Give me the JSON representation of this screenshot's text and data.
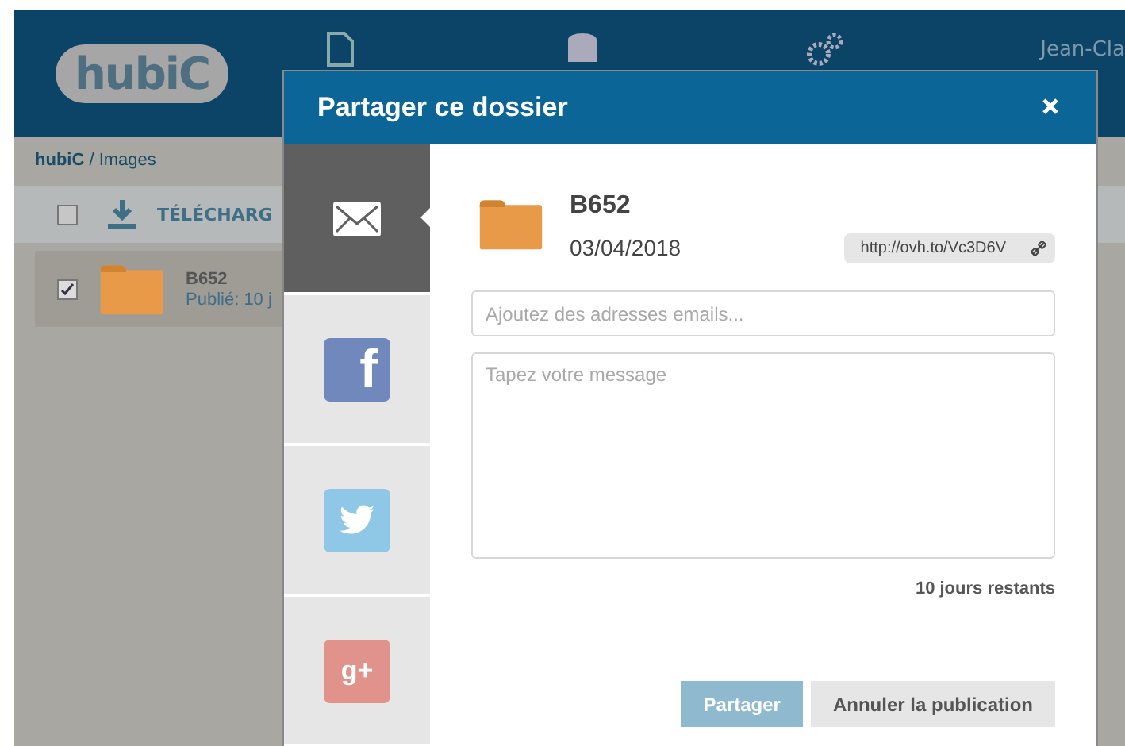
{
  "header": {
    "logo": "hubiC",
    "user": "Jean-Cla"
  },
  "breadcrumb": "**hubiC** / Images",
  "toolbar": {
    "select_all_checked": false,
    "download_label": "TÉLÉCHARG"
  },
  "files": [
    {
      "name": "B652",
      "status": "Publié: 10 j",
      "checked": true,
      "selected": true
    }
  ],
  "dialog": {
    "title": "Partager ce dossier",
    "share_tabs": [
      {
        "kind": "email",
        "selected": true
      },
      {
        "kind": "facebook",
        "glyph": "f",
        "selected": false
      },
      {
        "kind": "twitter",
        "selected": false
      },
      {
        "kind": "googleplus",
        "glyph": "g+",
        "selected": false
      }
    ],
    "folder_name": "B652",
    "date": "03/04/2018",
    "link": "http://ovh.to/Vc3D6V",
    "email_placeholder": "Ajoutez des adresses emails...",
    "message_placeholder": "Tapez votre message",
    "remaining": "10 jours restants",
    "buttons": [
      {
        "label": "Partager",
        "disabled": true,
        "kind": "primary"
      },
      {
        "label": "Annuler la publication",
        "disabled": false,
        "kind": "secondary"
      }
    ]
  }
}
